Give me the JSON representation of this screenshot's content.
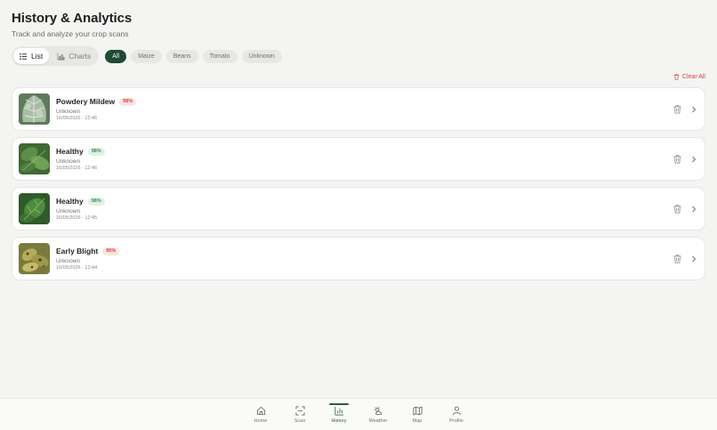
{
  "header": {
    "title": "History & Analytics",
    "subtitle": "Track and analyze your crop scans"
  },
  "view_toggle": {
    "list_label": "List",
    "charts_label": "Charts",
    "active": "list"
  },
  "filters": [
    {
      "label": "All",
      "active": true
    },
    {
      "label": "Maize",
      "active": false
    },
    {
      "label": "Beans",
      "active": false
    },
    {
      "label": "Tomato",
      "active": false
    },
    {
      "label": "Unknown",
      "active": false
    }
  ],
  "clear_all_label": "Clear All",
  "scans": [
    {
      "disease": "Powdery Mildew",
      "confidence": "98%",
      "status": "warn",
      "crop": "Unknown",
      "date": "16/05/2026 · 12:46",
      "thumb": "mildew"
    },
    {
      "disease": "Healthy",
      "confidence": "98%",
      "status": "ok",
      "crop": "Unknown",
      "date": "16/05/2026 · 12:46",
      "thumb": "healthy1"
    },
    {
      "disease": "Healthy",
      "confidence": "98%",
      "status": "ok",
      "crop": "Unknown",
      "date": "16/05/2026 · 12:45",
      "thumb": "healthy2"
    },
    {
      "disease": "Early Blight",
      "confidence": "95%",
      "status": "warn",
      "crop": "Unknown",
      "date": "16/05/2026 · 12:44",
      "thumb": "blight"
    }
  ],
  "nav": [
    {
      "label": "Home",
      "icon": "home-icon",
      "active": false
    },
    {
      "label": "Scan",
      "icon": "scan-icon",
      "active": false
    },
    {
      "label": "History",
      "icon": "bar-chart-icon",
      "active": true
    },
    {
      "label": "Weather",
      "icon": "weather-icon",
      "active": false
    },
    {
      "label": "Map",
      "icon": "map-icon",
      "active": false
    },
    {
      "label": "Profile",
      "icon": "user-icon",
      "active": false
    }
  ],
  "colors": {
    "primary": "#1f4a33",
    "danger": "#d24a3a",
    "success": "#3b8a57",
    "background": "#f4f4f2"
  }
}
